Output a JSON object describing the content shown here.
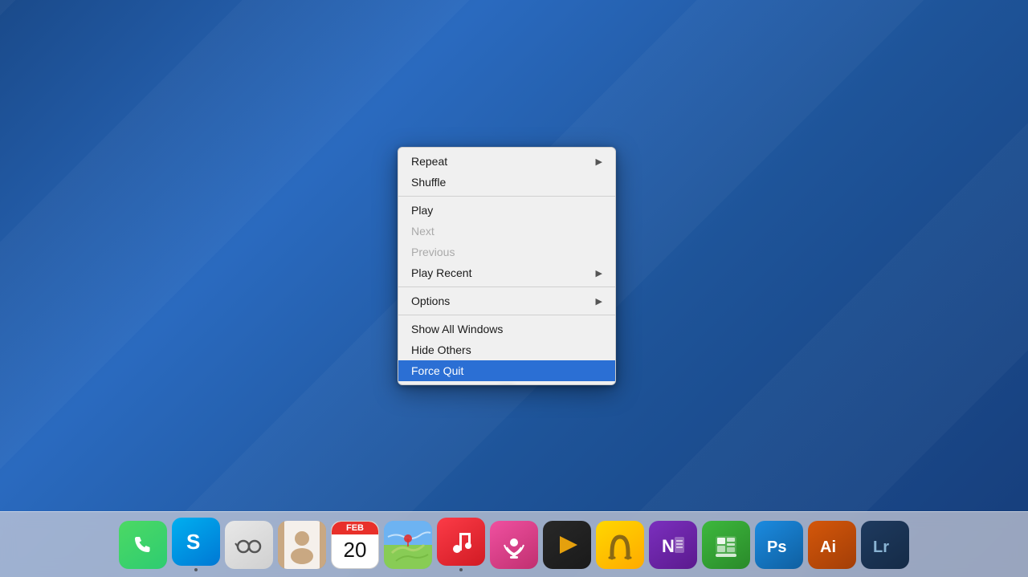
{
  "desktop": {
    "background": "macOS blue gradient"
  },
  "context_menu": {
    "sections": [
      {
        "id": "section-repeat-shuffle",
        "items": [
          {
            "id": "repeat",
            "label": "Repeat",
            "has_arrow": true,
            "disabled": false,
            "highlighted": false
          },
          {
            "id": "shuffle",
            "label": "Shuffle",
            "has_arrow": false,
            "disabled": false,
            "highlighted": false
          }
        ]
      },
      {
        "id": "section-playback",
        "items": [
          {
            "id": "play",
            "label": "Play",
            "has_arrow": false,
            "disabled": false,
            "highlighted": false
          },
          {
            "id": "next",
            "label": "Next",
            "has_arrow": false,
            "disabled": true,
            "highlighted": false
          },
          {
            "id": "previous",
            "label": "Previous",
            "has_arrow": false,
            "disabled": true,
            "highlighted": false
          },
          {
            "id": "play-recent",
            "label": "Play Recent",
            "has_arrow": true,
            "disabled": false,
            "highlighted": false
          }
        ]
      },
      {
        "id": "section-options",
        "items": [
          {
            "id": "options",
            "label": "Options",
            "has_arrow": true,
            "disabled": false,
            "highlighted": false
          }
        ]
      },
      {
        "id": "section-window",
        "items": [
          {
            "id": "show-all-windows",
            "label": "Show All Windows",
            "has_arrow": false,
            "disabled": false,
            "highlighted": false
          },
          {
            "id": "hide-others",
            "label": "Hide Others",
            "has_arrow": false,
            "disabled": false,
            "highlighted": false
          },
          {
            "id": "force-quit",
            "label": "Force Quit",
            "has_arrow": false,
            "disabled": false,
            "highlighted": true
          }
        ]
      }
    ]
  },
  "dock": {
    "items": [
      {
        "id": "phone",
        "label": "Phone",
        "icon_class": "icon-phone",
        "symbol": "📞",
        "has_dot": false
      },
      {
        "id": "skype",
        "label": "Skype",
        "icon_class": "icon-skype",
        "symbol": "S",
        "has_dot": true
      },
      {
        "id": "papers",
        "label": "Papers",
        "icon_class": "icon-papers",
        "symbol": "📄",
        "has_dot": false
      },
      {
        "id": "contacts",
        "label": "Contacts",
        "icon_class": "icon-contacts",
        "symbol": "👤",
        "has_dot": false
      },
      {
        "id": "calendar",
        "label": "Calendar",
        "icon_class": "icon-calendar",
        "symbol": "20",
        "has_dot": false
      },
      {
        "id": "maps",
        "label": "Maps",
        "icon_class": "icon-maps",
        "symbol": "🗺",
        "has_dot": false
      },
      {
        "id": "itunes",
        "label": "iTunes",
        "icon_class": "icon-itunes",
        "symbol": "♪",
        "has_dot": true
      },
      {
        "id": "podcasts",
        "label": "Podcasts",
        "icon_class": "icon-podcasts",
        "symbol": "🎙",
        "has_dot": false
      },
      {
        "id": "plex",
        "label": "Plex",
        "icon_class": "icon-plex",
        "symbol": "▶",
        "has_dot": false
      },
      {
        "id": "unison",
        "label": "Unison",
        "icon_class": "icon-unison",
        "symbol": "U",
        "has_dot": false
      },
      {
        "id": "onenote",
        "label": "OneNote",
        "icon_class": "icon-onenote",
        "symbol": "N",
        "has_dot": false
      },
      {
        "id": "numbers",
        "label": "Numbers",
        "icon_class": "icon-numbers",
        "symbol": "≡",
        "has_dot": false
      },
      {
        "id": "photoshop",
        "label": "Photoshop",
        "icon_class": "icon-photoshop",
        "symbol": "Ps",
        "has_dot": false
      },
      {
        "id": "illustrator",
        "label": "Illustrator",
        "icon_class": "icon-illustrator",
        "symbol": "Ai",
        "has_dot": false
      },
      {
        "id": "lightroom",
        "label": "Lightroom",
        "icon_class": "icon-lightroom",
        "symbol": "Lr",
        "has_dot": false
      }
    ],
    "calendar_month": "FEB",
    "calendar_day": "20"
  }
}
